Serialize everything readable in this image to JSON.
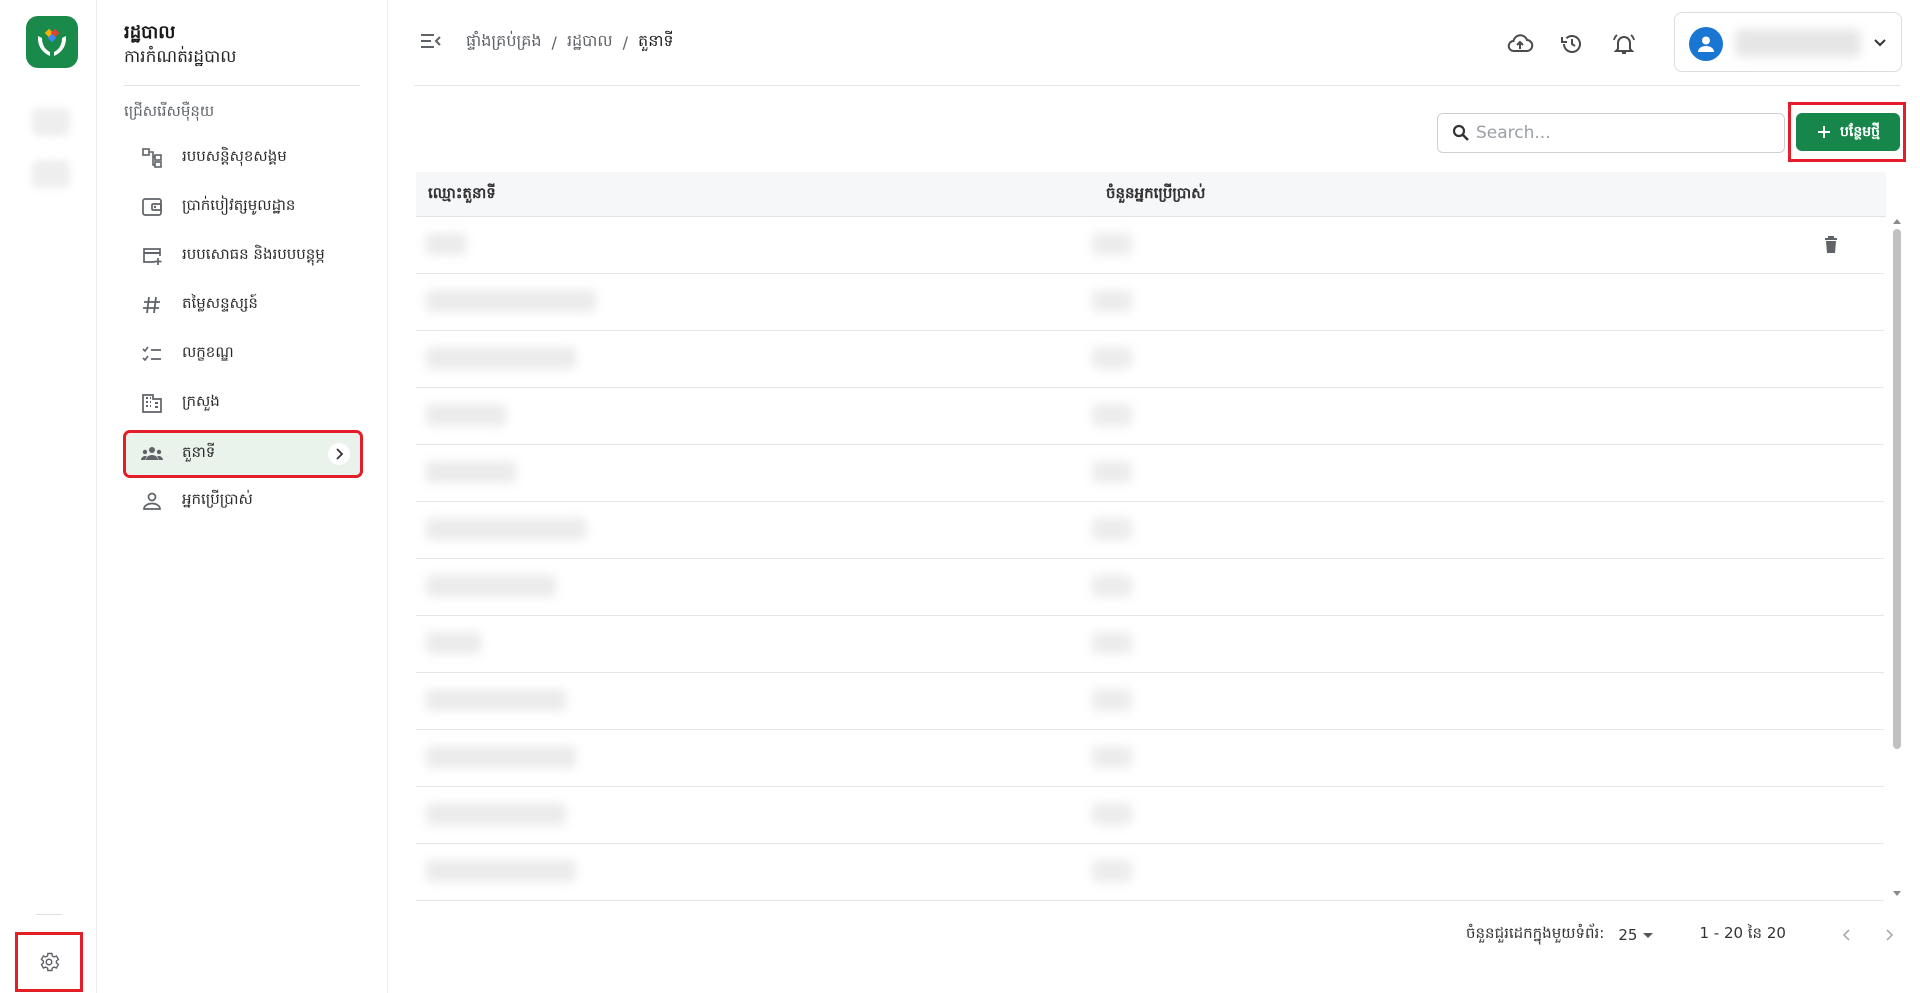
{
  "rail": {
    "logo": "app-logo",
    "settings_icon": "gear-icon"
  },
  "sidebar": {
    "title": "រដ្ឋបាល",
    "subtitle": "ការកំណត់រដ្ឋបាល",
    "section_label": "ជ្រើសរើសម៉ឺនុយ",
    "items": [
      {
        "label": "របបសន្តិសុខសង្គម",
        "icon": "hierarchy-icon"
      },
      {
        "label": "ប្រាក់បៀវត្សមូលដ្ឋាន",
        "icon": "wallet-icon"
      },
      {
        "label": "របបសោធន និងរបបបន្តុម្ភ",
        "icon": "card-add-icon"
      },
      {
        "label": "តម្លៃសន្ទស្សន៍",
        "icon": "hash-icon"
      },
      {
        "label": "លក្ខខណ្ឌ",
        "icon": "checklist-icon"
      },
      {
        "label": "ក្រសួង",
        "icon": "building-icon"
      },
      {
        "label": "តួនាទី",
        "icon": "group-icon",
        "active": true
      },
      {
        "label": "អ្នកប្រើប្រាស់",
        "icon": "person-icon"
      }
    ]
  },
  "header": {
    "breadcrumb": [
      "ផ្ទាំងគ្រប់គ្រង",
      "រដ្ឋបាល",
      "តួនាទី"
    ],
    "separator": "/",
    "icons": [
      "cloud-upload-icon",
      "history-icon",
      "bell-icon"
    ]
  },
  "toolbar": {
    "search_placeholder": "Search...",
    "search_value": "",
    "add_label": "បន្ថែមថ្មី"
  },
  "table": {
    "columns": [
      "ឈ្មោះតួនាទី",
      "ចំនួនអ្នកប្រើប្រាស់"
    ],
    "rows": [
      {
        "name": "",
        "count": ""
      },
      {
        "name": "",
        "count": ""
      },
      {
        "name": "",
        "count": ""
      },
      {
        "name": "",
        "count": ""
      },
      {
        "name": "",
        "count": ""
      },
      {
        "name": "",
        "count": ""
      },
      {
        "name": "",
        "count": ""
      },
      {
        "name": "",
        "count": ""
      },
      {
        "name": "",
        "count": ""
      },
      {
        "name": "",
        "count": ""
      },
      {
        "name": "",
        "count": ""
      },
      {
        "name": "",
        "count": ""
      }
    ]
  },
  "pagination": {
    "rows_per_page_label": "ចំនួនជួរដេកក្នុងមួយទំព័រ:",
    "rows_per_page": "25",
    "range": "1 - 20 នៃ 20"
  },
  "colors": {
    "primary": "#17864a",
    "highlight": "#e41e26",
    "avatar": "#1976d2"
  }
}
